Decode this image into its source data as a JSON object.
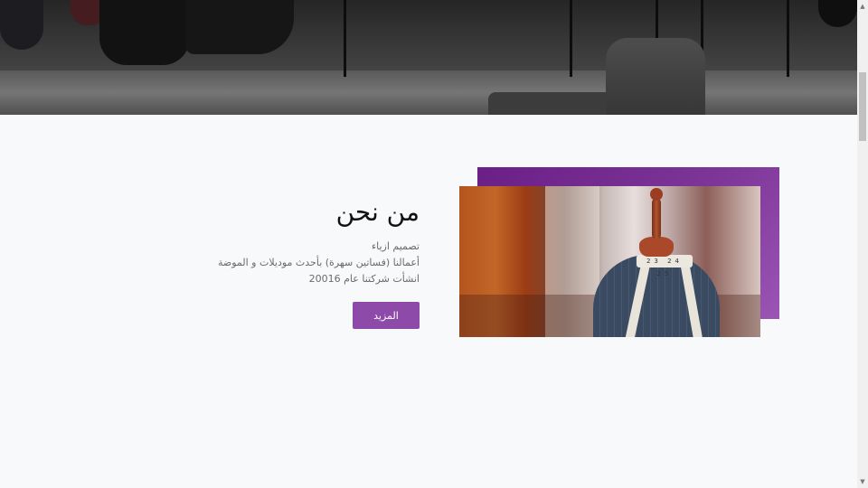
{
  "about": {
    "title": "من نحن",
    "lines": [
      "تصميم ازياء",
      "أعمالنا (فساتين سهرة) بأحدث موديلات و الموضة",
      "انشأت شركتنا عام 20016"
    ],
    "button_label": "المزيد"
  },
  "photo": {
    "tape_text": "23 24 25"
  },
  "colors": {
    "accent": "#8e4aa8",
    "frame": "#7d3598",
    "background": "#f8f9fb"
  },
  "icons": {
    "scroll_up": "triangle-up",
    "scroll_down": "triangle-down"
  }
}
